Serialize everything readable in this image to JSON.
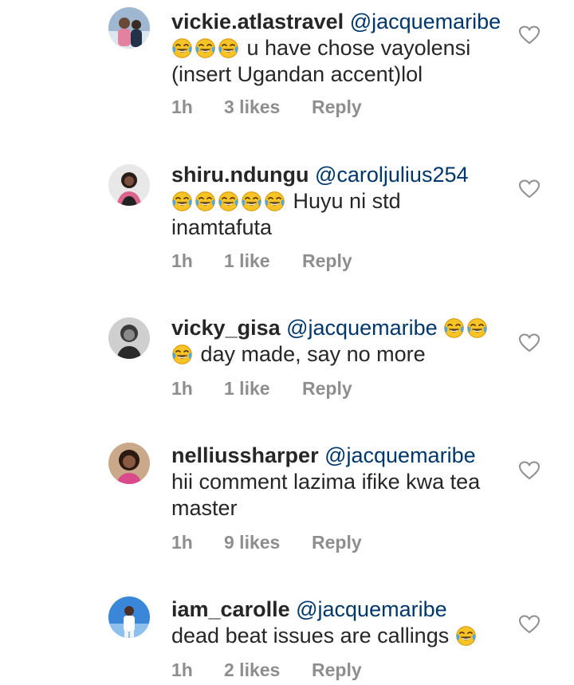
{
  "comments": [
    {
      "username": "vickie.atlastravel",
      "mention": "@jacquemaribe",
      "emoji_count": 3,
      "text_line1": "u have chose vayolensi",
      "text_line2": "(insert Ugandan accent)lol",
      "time": "1h",
      "likes": "3 likes",
      "reply": "Reply"
    },
    {
      "username": "shiru.ndungu",
      "mention": "@caroljulius254",
      "emoji_count": 5,
      "text_line1": "Huyu ni std",
      "text_line2": "inamtafuta",
      "time": "1h",
      "likes": "1 like",
      "reply": "Reply"
    },
    {
      "username": "vicky_gisa",
      "mention": "@jacquemaribe",
      "emoji_count": 3,
      "text_line2": "day made, say no more",
      "time": "1h",
      "likes": "1 like",
      "reply": "Reply"
    },
    {
      "username": "nelliussharper",
      "mention": "@jacquemaribe",
      "text_line2": "hii comment lazima ifike kwa tea",
      "text_line3": "master",
      "time": "1h",
      "likes": "9 likes",
      "reply": "Reply"
    },
    {
      "username": "iam_carolle",
      "mention": "@jacquemaribe",
      "text_line2": "dead beat issues are callings",
      "emoji_count": 1,
      "time": "1h",
      "likes": "2 likes",
      "reply": "Reply"
    }
  ],
  "icons": {
    "emoji": "tears-of-joy-emoji",
    "like": "heart-outline-icon"
  }
}
